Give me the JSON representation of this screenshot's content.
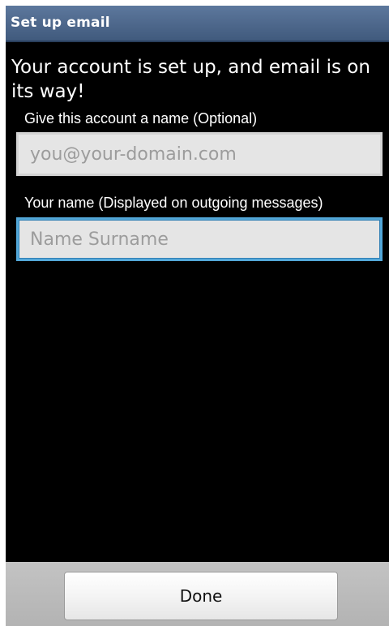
{
  "title_bar": {
    "title": "Set up email"
  },
  "main": {
    "headline": "Your account is set up, and email is on its way!",
    "account_name": {
      "label": "Give this account a name (Optional)",
      "value": "",
      "placeholder": "you@your-domain.com"
    },
    "your_name": {
      "label": "Your name (Displayed on outgoing messages)",
      "value": "",
      "placeholder": "Name Surname",
      "focused": true
    }
  },
  "bottom_bar": {
    "done_label": "Done"
  },
  "colors": {
    "title_bar": "#4d678b",
    "background": "#000000",
    "input_background": "#e5e5e5",
    "focus_border": "#53a7d8",
    "bottom_bar": "#bbbbbb"
  }
}
